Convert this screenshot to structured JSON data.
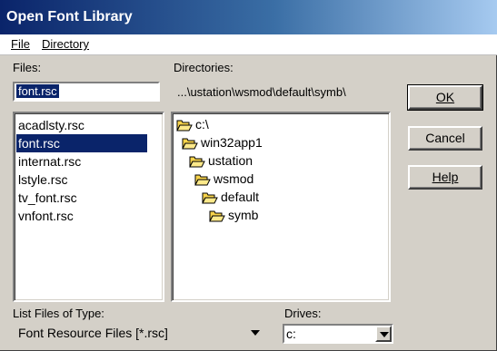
{
  "window": {
    "title": "Open Font Library"
  },
  "menu": [
    {
      "label": "File",
      "underline": "F"
    },
    {
      "label": "Directory",
      "underline": "D"
    }
  ],
  "files": {
    "label": "Files:",
    "filename_value": "font.rsc",
    "items": [
      "acadlsty.rsc",
      "font.rsc",
      "internat.rsc",
      "lstyle.rsc",
      "tv_font.rsc",
      "vnfont.rsc"
    ],
    "selected": "font.rsc"
  },
  "directories": {
    "label": "Directories:",
    "current_path": "...\\ustation\\wsmod\\default\\symb\\",
    "tree": [
      {
        "name": "c:\\",
        "level": 0,
        "icon": "open-folder-icon"
      },
      {
        "name": "win32app1",
        "level": 1,
        "icon": "open-folder-icon"
      },
      {
        "name": "ustation",
        "level": 2,
        "icon": "open-folder-icon"
      },
      {
        "name": "wsmod",
        "level": 3,
        "icon": "open-folder-icon"
      },
      {
        "name": "default",
        "level": 4,
        "icon": "open-folder-icon"
      },
      {
        "name": "symb",
        "level": 5,
        "icon": "open-folder-icon"
      }
    ]
  },
  "buttons": {
    "ok": "OK",
    "cancel": "Cancel",
    "help": "Help"
  },
  "file_type": {
    "label": "List Files of Type:",
    "value": "Font Resource Files [*.rsc]"
  },
  "drives": {
    "label": "Drives:",
    "value": "c:"
  },
  "colors": {
    "title_start": "#0a246a",
    "title_end": "#a6caf0",
    "selection": "#0a246a",
    "folder": "#f7d34a"
  }
}
